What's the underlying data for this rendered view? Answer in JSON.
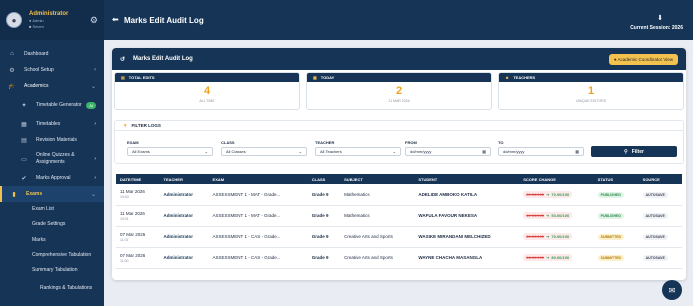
{
  "sidebar": {
    "user": {
      "name": "Administrator",
      "role": "Admin",
      "school": "Seven"
    },
    "items": [
      {
        "label": "Dashboard",
        "icon": "home-icon"
      },
      {
        "label": "School Setup",
        "icon": "gear-icon"
      },
      {
        "label": "Academics",
        "icon": "graduation-cap-icon"
      }
    ],
    "academics_sub": [
      {
        "label": "Timetable Generator",
        "badge": "AI"
      },
      {
        "label": "Timetables"
      },
      {
        "label": "Revision Materials"
      },
      {
        "label": "Online Quizzes & Assignments"
      },
      {
        "label": "Marks Approval"
      }
    ],
    "exams_label": "Exams",
    "exams_sub": [
      "Exam List",
      "Grade Settings",
      "Marks",
      "Comprehensive Tabulation",
      "Summary Tabulation",
      "Rankings & Tabulations"
    ]
  },
  "topbar": {
    "title": "Marks Edit Audit Log",
    "session": "Current Session: 2026"
  },
  "card": {
    "title": "Marks Edit Audit Log",
    "view_button": "Academic Coordinator View"
  },
  "stats": [
    {
      "label": "TOTAL EDITS",
      "value": "4",
      "sub": "ALL TIME"
    },
    {
      "label": "TODAY",
      "value": "2",
      "sub": "11 MAR 2026"
    },
    {
      "label": "TEACHERS",
      "value": "1",
      "sub": "UNIQUE EDITORS"
    }
  ],
  "filters": {
    "title": "FILTER LOGS",
    "exam": {
      "label": "EXAM",
      "value": "All Exams"
    },
    "class": {
      "label": "CLASS",
      "value": "All Classes"
    },
    "teacher": {
      "label": "TEACHER",
      "value": "All Teachers"
    },
    "from": {
      "label": "FROM",
      "value": "dd/mm/yyyy"
    },
    "to": {
      "label": "TO",
      "value": "dd/mm/yyyy"
    },
    "button": "Filter"
  },
  "table": {
    "headers": [
      "DATE/TIME",
      "TEACHER",
      "EXAM",
      "CLASS",
      "SUBJECT",
      "STUDENT",
      "SCORE CHANGE",
      "STATUS",
      "SOURCE"
    ],
    "rows": [
      {
        "date": "11 Mar 2026",
        "time": "19:03",
        "teacher": "Administrator",
        "exam": "ASSESSMENT 1 - MAT - Grade...",
        "class": "Grade 9",
        "subject": "Mathematics",
        "student": "ADELIDE AMBOKO KATILA",
        "old": "50.00/100",
        "new": "70.00/100",
        "status": "PUBLISHED",
        "source": "AUTOSAVE"
      },
      {
        "date": "11 Mar 2026",
        "time": "19:01",
        "teacher": "Administrator",
        "exam": "ASSESSMENT 1 - MAT - Grade...",
        "class": "Grade 9",
        "subject": "Mathematics",
        "student": "WAFULA FAVOUR NEKESA",
        "old": "42.00/100",
        "new": "53.00/100",
        "status": "PUBLISHED",
        "source": "AUTOSAVE"
      },
      {
        "date": "07 Mar 2026",
        "time": "11:01",
        "teacher": "Administrator",
        "exam": "ASSESSMENT 1 - CAS - Grade...",
        "class": "Grade 9",
        "subject": "Creative Arts and Sports",
        "student": "WASIKE MIRANDANI MELCHIZED",
        "old": "60.00/100",
        "new": "70.00/100",
        "status": "SUBMITTED",
        "source": "AUTOSAVE"
      },
      {
        "date": "07 Mar 2026",
        "time": "11:00",
        "teacher": "Administrator",
        "exam": "ASSESSMENT 1 - CAS - Grade...",
        "class": "Grade 9",
        "subject": "Creative Arts and Sports",
        "student": "WAYNE CHACHA MASANGLA",
        "old": "66.00/100",
        "new": "80.00/100",
        "status": "SUBMITTED",
        "source": "AUTOSAVE"
      }
    ]
  }
}
